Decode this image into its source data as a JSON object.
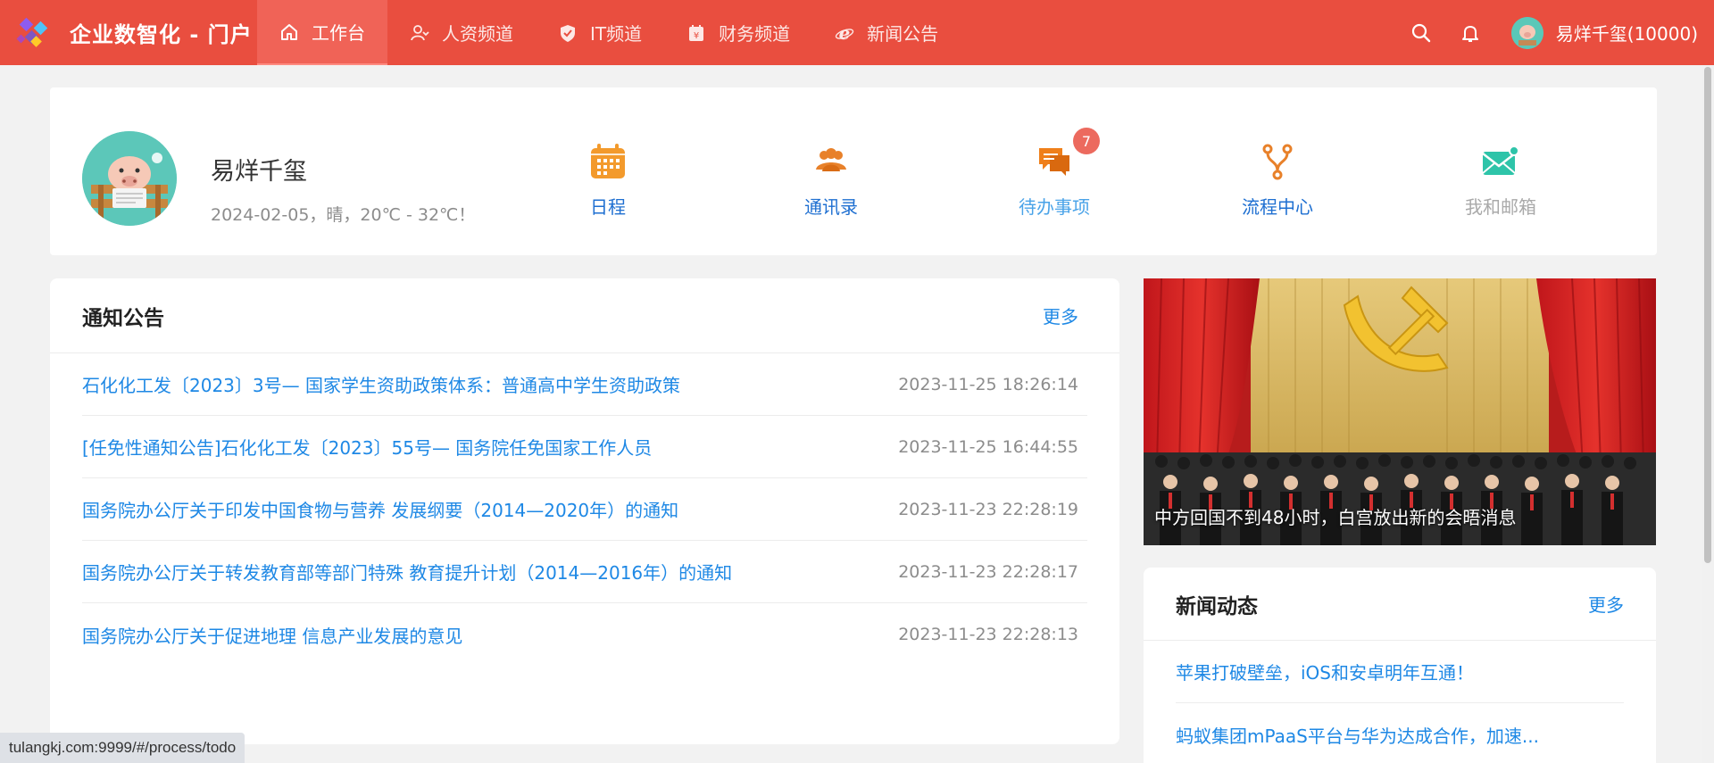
{
  "header": {
    "brand_title": "企业数智化 - 门户",
    "nav": [
      {
        "label": "工作台",
        "icon": "home-icon",
        "active": true
      },
      {
        "label": "人资频道",
        "icon": "user-icon",
        "active": false
      },
      {
        "label": "IT频道",
        "icon": "shield-icon",
        "active": false
      },
      {
        "label": "财务频道",
        "icon": "finance-icon",
        "active": false
      },
      {
        "label": "新闻公告",
        "icon": "ie-icon",
        "active": false
      }
    ],
    "user_display": "易烊千玺(10000)"
  },
  "profile": {
    "name": "易烊千玺",
    "weather": "2024-02-05，晴，20℃ - 32℃！"
  },
  "shortcuts": [
    {
      "label": "日程",
      "icon": "calendar-icon"
    },
    {
      "label": "通讯录",
      "icon": "contacts-icon"
    },
    {
      "label": "待办事项",
      "icon": "chat-icon",
      "badge": "7"
    },
    {
      "label": "流程中心",
      "icon": "flow-icon"
    },
    {
      "label": "我和邮箱",
      "icon": "mail-icon"
    }
  ],
  "notices": {
    "title": "通知公告",
    "more": "更多",
    "items": [
      {
        "title": "石化化工发〔2023〕3号— 国家学生资助政策体系：普通高中学生资助政策",
        "time": "2023-11-25 18:26:14"
      },
      {
        "title": "[任免性通知公告]石化化工发〔2023〕55号— 国务院任免国家工作人员",
        "time": "2023-11-25 16:44:55"
      },
      {
        "title": "国务院办公厅关于印发中国食物与营养 发展纲要（2014—2020年）的通知",
        "time": "2023-11-23 22:28:19"
      },
      {
        "title": "国务院办公厅关于转发教育部等部门特殊 教育提升计划（2014—2016年）的通知",
        "time": "2023-11-23 22:28:17"
      },
      {
        "title": "国务院办公厅关于促进地理 信息产业发展的意见",
        "time": "2023-11-23 22:28:13"
      }
    ]
  },
  "banner": {
    "caption": "中方回国不到48小时，白宫放出新的会晤消息"
  },
  "news": {
    "title": "新闻动态",
    "more": "更多",
    "items": [
      {
        "title": "苹果打破壁垒，iOS和安卓明年互通！"
      },
      {
        "title": "蚂蚁集团mPaaS平台与华为达成合作，加速..."
      }
    ]
  },
  "status_bar": {
    "url": "tulangkj.com:9999/#/process/todo"
  },
  "colors": {
    "header_bg": "#e94e3f",
    "link_blue": "#1e88e5",
    "badge_red": "#ec6a5e"
  }
}
